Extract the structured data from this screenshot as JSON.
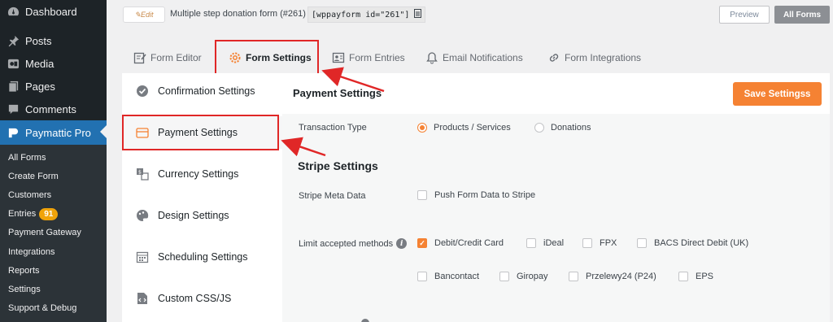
{
  "sidebar": {
    "menu": [
      {
        "label": "Dashboard",
        "icon": "dashboard-icon"
      },
      {
        "label": "Posts",
        "icon": "pin-icon"
      },
      {
        "label": "Media",
        "icon": "media-icon"
      },
      {
        "label": "Pages",
        "icon": "pages-icon"
      },
      {
        "label": "Comments",
        "icon": "comment-icon"
      },
      {
        "label": "Paymattic Pro",
        "icon": "paymattic-icon"
      }
    ],
    "submenu": [
      "All Forms",
      "Create Form",
      "Customers",
      "Entries",
      "Payment Gateway",
      "Integrations",
      "Reports",
      "Settings",
      "Support & Debug"
    ],
    "entries_badge": "91"
  },
  "topbar": {
    "edit_label": "Edit",
    "form_title": "Multiple step donation form (#261)",
    "shortcode": "[wppayform id=\"261\"]",
    "preview_label": "Preview",
    "all_forms_label": "All Forms"
  },
  "tabs": [
    "Form Editor",
    "Form Settings",
    "Form Entries",
    "Email Notifications",
    "Form Integrations"
  ],
  "settings_nav": [
    "Confirmation Settings",
    "Payment Settings",
    "Currency Settings",
    "Design Settings",
    "Scheduling Settings",
    "Custom CSS/JS"
  ],
  "panel": {
    "title": "Payment Settings",
    "save_label": "Save Settingss",
    "transaction_type_label": "Transaction Type",
    "transaction_options": [
      "Products / Services",
      "Donations"
    ],
    "transaction_selected": "Products / Services",
    "stripe_title": "Stripe Settings",
    "stripe_meta_label": "Stripe Meta Data",
    "stripe_meta_option": "Push Form Data to Stripe",
    "limit_methods_label": "Limit accepted methods",
    "methods_row1": [
      "Debit/Credit Card",
      "iDeal",
      "FPX",
      "BACS Direct Debit (UK)"
    ],
    "methods_row2": [
      "Bancontact",
      "Giropay",
      "Przelewy24 (P24)",
      "EPS"
    ],
    "methods_checked": [
      "Debit/Credit Card"
    ]
  },
  "colors": {
    "accent": "#f58233",
    "highlight": "#e02727",
    "wp_admin_bg": "#1d2327",
    "wp_active": "#2271b1"
  }
}
